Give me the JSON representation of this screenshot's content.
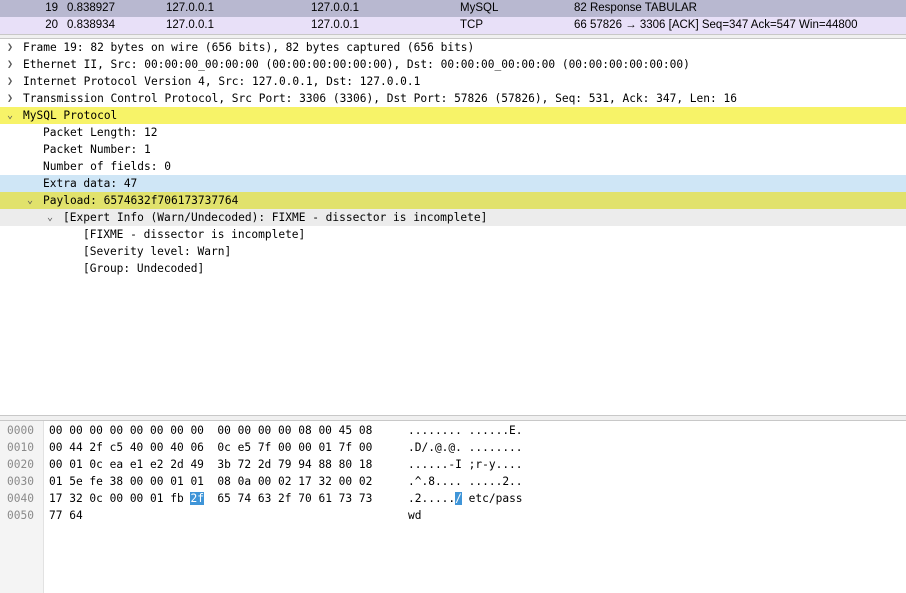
{
  "colors": {
    "pkt_row_19": "#b8b8d0",
    "pkt_row_20": "#e8e0f8",
    "mysql_highlight": "#f7f368",
    "payload_highlight": "#e1e26c",
    "extra_data_highlight": "#cfe6f6",
    "expert_row": "#ececec",
    "byte_selection": "#3f95d8"
  },
  "packet_list": [
    {
      "no": "19",
      "time": "0.838927",
      "source": "127.0.0.1",
      "destination": "127.0.0.1",
      "protocol": "MySQL",
      "info": "82 Response TABULAR"
    },
    {
      "no": "20",
      "time": "0.838934",
      "source": "127.0.0.1",
      "destination": "127.0.0.1",
      "protocol": "TCP",
      "info": "66 57826 → 3306 [ACK] Seq=347 Ack=547 Win=44800"
    }
  ],
  "details": [
    {
      "text": "Frame 19: 82 bytes on wire (656 bits), 82 bytes captured (656 bits)",
      "arrow": "collapsed",
      "icon": "chevron-right-icon"
    },
    {
      "text": "Ethernet II, Src: 00:00:00_00:00:00 (00:00:00:00:00:00), Dst: 00:00:00_00:00:00 (00:00:00:00:00:00)",
      "arrow": "collapsed",
      "icon": "chevron-right-icon"
    },
    {
      "text": "Internet Protocol Version 4, Src: 127.0.0.1, Dst: 127.0.0.1",
      "arrow": "collapsed",
      "icon": "chevron-right-icon"
    },
    {
      "text": "Transmission Control Protocol, Src Port: 3306 (3306), Dst Port: 57826 (57826), Seq: 531, Ack: 347, Len: 16",
      "arrow": "collapsed",
      "icon": "chevron-right-icon"
    },
    {
      "text": "MySQL Protocol",
      "arrow": "expanded",
      "icon": "chevron-down-icon"
    },
    {
      "text": "Packet Length: 12"
    },
    {
      "text": "Packet Number: 1"
    },
    {
      "text": "Number of fields: 0"
    },
    {
      "text": "Extra data: 47"
    },
    {
      "text": "Payload: 6574632f706173737764",
      "arrow": "expanded",
      "icon": "chevron-down-icon"
    },
    {
      "text": "[Expert Info (Warn/Undecoded): FIXME - dissector is incomplete]",
      "arrow": "expanded",
      "icon": "chevron-down-icon"
    },
    {
      "text": "[FIXME - dissector is incomplete]"
    },
    {
      "text": "[Severity level: Warn]"
    },
    {
      "text": "[Group: Undecoded]"
    }
  ],
  "bytes": [
    {
      "offset": "0000",
      "hex_a": "00 00 00 00 00 00 00 00",
      "hex_b": "00 00 00 00 08 00 45 08",
      "ascii_a": "........",
      "ascii_b": "......E."
    },
    {
      "offset": "0010",
      "hex_a": "00 44 2f c5 40 00 40 06",
      "hex_b": "0c e5 7f 00 00 01 7f 00",
      "ascii_a": ".D/.@.@.",
      "ascii_b": "........"
    },
    {
      "offset": "0020",
      "hex_a": "00 01 0c ea e1 e2 2d 49",
      "hex_b": "3b 72 2d 79 94 88 80 18",
      "ascii_a": "......-I",
      "ascii_b": ";r-y...."
    },
    {
      "offset": "0030",
      "hex_a": "01 5e fe 38 00 00 01 01",
      "hex_b": "08 0a 00 02 17 32 00 02",
      "ascii_a": ".^.8....",
      "ascii_b": ".....2.."
    },
    {
      "offset": "0040",
      "hex_a_pre": "17 32 0c 00 00 01 fb ",
      "hex_sel": "2f",
      "hex_b": "65 74 63 2f 70 61 73 73",
      "ascii_a_pre": ".2.....",
      "ascii_sel": "/",
      "ascii_b": "etc/pass"
    },
    {
      "offset": "0050",
      "hex_a": "77 64",
      "hex_b": "",
      "ascii_a": "wd",
      "ascii_b": ""
    }
  ]
}
